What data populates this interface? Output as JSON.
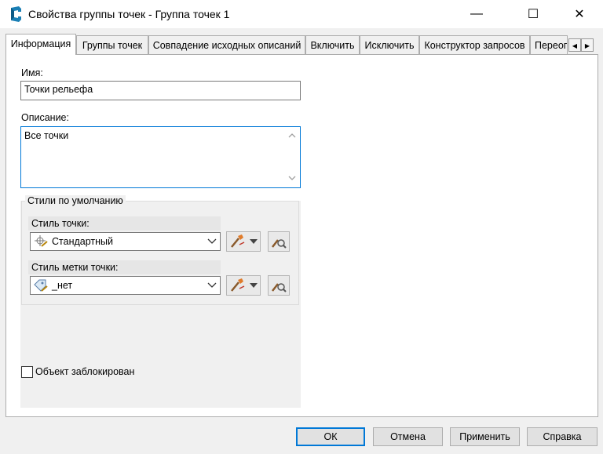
{
  "window": {
    "title": "Свойства группы точек - Группа точек 1",
    "minimize_glyph": "—",
    "maximize_glyph": "☐",
    "close_glyph": "✕",
    "app_icon": "civil3d-c-icon"
  },
  "tabs": [
    {
      "label": "Информация",
      "active": true
    },
    {
      "label": "Группы точек"
    },
    {
      "label": "Совпадение исходных описаний"
    },
    {
      "label": "Включить"
    },
    {
      "label": "Исключить"
    },
    {
      "label": "Конструктор запросов"
    },
    {
      "label": "Переопр"
    }
  ],
  "tab_scroll": {
    "left": "◀",
    "right": "▶"
  },
  "info": {
    "name_label": "Имя:",
    "name_value": "Точки рельефа",
    "description_label": "Описание:",
    "description_value": "Все точки"
  },
  "default_styles": {
    "group_title": "Стили по умолчанию",
    "point_style_label": "Стиль точки:",
    "point_style_value": "Стандартный",
    "point_label_style_label": "Стиль метки точки:",
    "point_label_style_value": "_нет"
  },
  "locked_label": "Объект заблокирован",
  "buttons": {
    "ok": "ОК",
    "cancel": "Отмена",
    "apply": "Применить",
    "help": "Справка"
  },
  "colors": {
    "accent": "#0078d7",
    "panel_bg": "#ffffff",
    "dialog_bg": "#f0f0f0"
  }
}
